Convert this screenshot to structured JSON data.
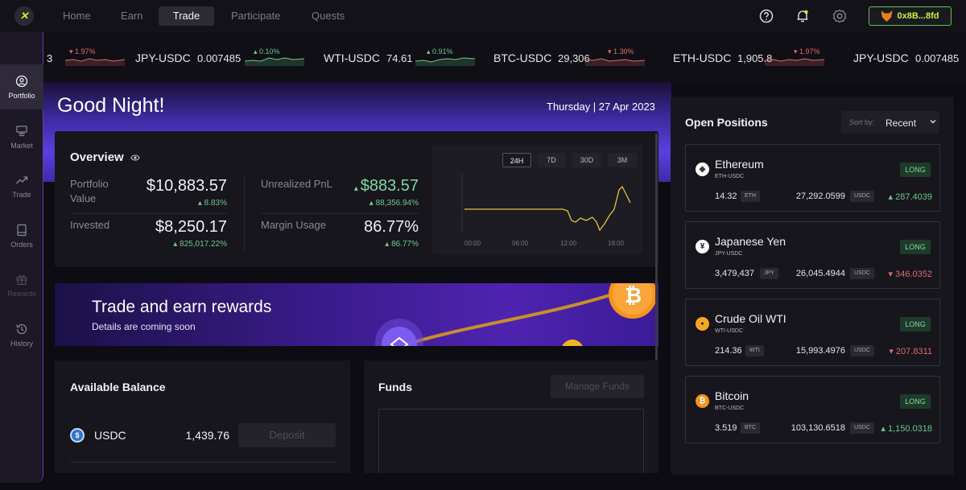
{
  "nav": {
    "logo": "✕",
    "items": [
      {
        "label": "Home",
        "active": false
      },
      {
        "label": "Earn",
        "active": false
      },
      {
        "label": "Trade",
        "active": true
      },
      {
        "label": "Participate",
        "active": false
      },
      {
        "label": "Quests",
        "active": false
      }
    ],
    "icons": [
      "help-icon",
      "bell-icon",
      "settings-icon"
    ],
    "wallet_label": "0x8B...8fd"
  },
  "ticker": [
    {
      "pair": "",
      "price": "",
      "change": "1.97%",
      "direction": "down"
    },
    {
      "pair": "JPY-USDC",
      "price": "0.007485",
      "change": "0.10%",
      "direction": "up"
    },
    {
      "pair": "WTI-USDC",
      "price": "74.61",
      "change": "0.91%",
      "direction": "up"
    },
    {
      "pair": "BTC-USDC",
      "price": "29,306",
      "change": "1.30%",
      "direction": "down"
    },
    {
      "pair": "ETH-USDC",
      "price": "1,905.8",
      "change": "1.97%",
      "direction": "down"
    },
    {
      "pair": "JPY-USDC",
      "price": "0.007485",
      "change": "",
      "direction": "up"
    }
  ],
  "sidebar": {
    "items": [
      {
        "label": "Portfolio",
        "icon": "portfolio-icon",
        "active": true
      },
      {
        "label": "Market",
        "icon": "market-icon",
        "active": false
      },
      {
        "label": "Trade",
        "icon": "trade-icon",
        "active": false
      },
      {
        "label": "Orders",
        "icon": "orders-icon",
        "active": false
      },
      {
        "label": "Rewards",
        "icon": "gift-icon",
        "active": false,
        "disabled": true
      },
      {
        "label": "History",
        "icon": "history-icon",
        "active": false
      }
    ]
  },
  "header": {
    "greeting": "Good Night!",
    "date": "Thursday | 27 Apr 2023"
  },
  "overview": {
    "title": "Overview",
    "portfolio_label": "Portfolio Value",
    "portfolio_value": "$10,883.57",
    "portfolio_change": "8.83%",
    "invested_label": "Invested",
    "invested_value": "$8,250.17",
    "invested_change": "825,017.22%",
    "pnl_label": "Unrealized PnL",
    "pnl_value": "$883.57",
    "pnl_change": "88,356.94%",
    "margin_label": "Margin Usage",
    "margin_value": "86.77%",
    "margin_change": "86.77%",
    "ranges": [
      {
        "label": "24H",
        "active": true
      },
      {
        "label": "7D",
        "active": false
      },
      {
        "label": "30D",
        "active": false
      },
      {
        "label": "3M",
        "active": false
      }
    ],
    "time_labels": [
      "00:00",
      "06:00",
      "12:00",
      "18:00"
    ],
    "line_color": "#e0c43c"
  },
  "banner": {
    "title": "Trade and earn rewards",
    "subtitle": "Details are coming soon"
  },
  "balance": {
    "title": "Available Balance",
    "currency": "USDC",
    "amount": "1,439.76",
    "deposit_label": "Deposit"
  },
  "funds": {
    "title": "Funds",
    "manage_label": "Manage Funds"
  },
  "positions": {
    "title": "Open Positions",
    "sort_label": "Sort by:",
    "sort_value": "Recent",
    "items": [
      {
        "name": "Ethereum",
        "pair": "ETH-USDC",
        "side": "LONG",
        "qty": "14.32",
        "unit": "ETH",
        "price": "27,292.0599",
        "quote": "USDC",
        "pnl": "287.4039",
        "direction": "up",
        "icon": "ethereum-icon",
        "icon_bg": "#ffffff",
        "icon_fg": "#3c3c3d",
        "glyph": "◆"
      },
      {
        "name": "Japanese Yen",
        "pair": "JPY-USDC",
        "side": "LONG",
        "qty": "3,479,437",
        "unit": "JPY",
        "price": "26,045.4944",
        "quote": "USDC",
        "pnl": "346.0352",
        "direction": "down",
        "icon": "yen-icon",
        "icon_bg": "#ffffff",
        "icon_fg": "#1b1a20",
        "glyph": "¥"
      },
      {
        "name": "Crude Oil WTI",
        "pair": "WTI-USDC",
        "side": "LONG",
        "qty": "214.36",
        "unit": "WTI",
        "price": "15,993.4976",
        "quote": "USDC",
        "pnl": "207.8311",
        "direction": "down",
        "icon": "oil-drop-icon",
        "icon_bg": "#f5a623",
        "icon_fg": "#1b1a20",
        "glyph": "●"
      },
      {
        "name": "Bitcoin",
        "pair": "BTC-USDC",
        "side": "LONG",
        "qty": "3.519",
        "unit": "BTC",
        "price": "103,130.6518",
        "quote": "USDC",
        "pnl": "1,150.0318",
        "direction": "up",
        "icon": "bitcoin-icon",
        "icon_bg": "#f7931a",
        "icon_fg": "#ffffff",
        "glyph": "₿"
      }
    ]
  },
  "colors": {
    "accent": "#c6f432",
    "up": "#6ec98a",
    "down": "#e06a6a",
    "sidebar_border": "#6a3aa8"
  }
}
